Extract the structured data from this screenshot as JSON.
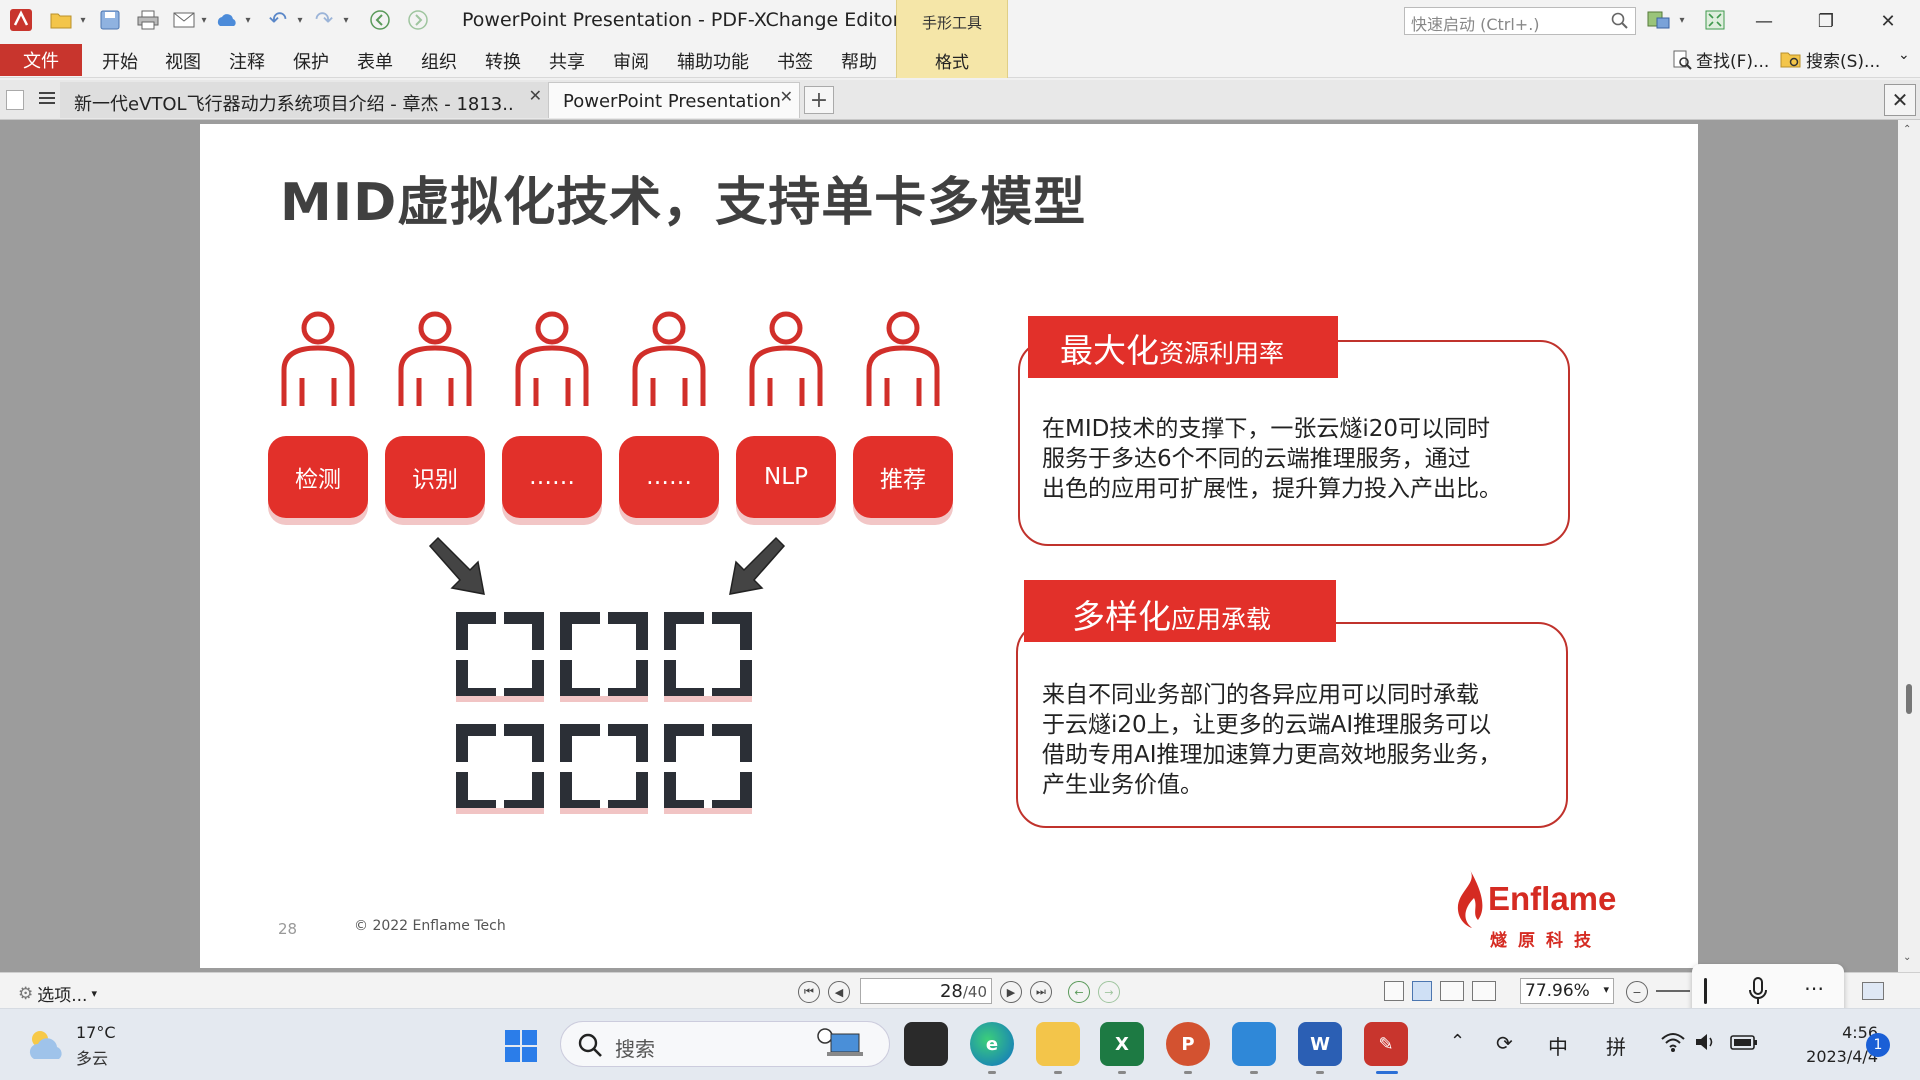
{
  "window": {
    "title": "PowerPoint Presentation - PDF-XChange Editor",
    "context_tab_group": "手形工具",
    "context_tab": "格式",
    "quick_launch_placeholder": "快速启动 (Ctrl+.)"
  },
  "menu": {
    "file": "文件",
    "items": [
      "开始",
      "视图",
      "注释",
      "保护",
      "表单",
      "组织",
      "转换",
      "共享",
      "审阅",
      "辅助功能",
      "书签",
      "帮助"
    ],
    "find": "查找(F)...",
    "search": "搜索(S)..."
  },
  "tabs": [
    {
      "label": "新一代eVTOL飞行器动力系统项目介绍 - 章杰 - 1813.."
    },
    {
      "label": "PowerPoint Presentation"
    }
  ],
  "slide": {
    "title": "MID虚拟化技术，支持单卡多模型",
    "pills": [
      "检测",
      "识别",
      "……",
      "……",
      "NLP",
      "推荐"
    ],
    "callout1": {
      "head_big": "最大化",
      "head_small": "资源利用率",
      "body": [
        "在MID技术的支撑下，一张云燧i20可以同时",
        "服务于多达6个不同的云端推理服务，通过",
        "出色的应用可扩展性，提升算力投入产出比。"
      ]
    },
    "callout2": {
      "head_big": "多样化",
      "head_small": "应用承载",
      "body": [
        "来自不同业务部门的各异应用可以同时承载",
        "于云燧i20上，让更多的云端AI推理服务可以",
        "借助专用AI推理加速算力更高效地服务业务，",
        "产生业务价值。"
      ]
    },
    "page_number": "28",
    "copyright": "© 2022 Enflame Tech",
    "logo_name": "Enflame",
    "logo_cn": "燧原科技"
  },
  "status": {
    "options": "选项...",
    "current_page": "28",
    "total_pages": "/40",
    "zoom": "77.96%"
  },
  "taskbar": {
    "temperature": "17°C",
    "weather": "多云",
    "search": "搜索",
    "ime_lang": "中",
    "ime_mode": "拼",
    "time": "4:56",
    "date": "2023/4/4",
    "notifications": "1"
  },
  "colors": {
    "brand_red": "#e2302a",
    "file_button": "#c8352d",
    "context_tab": "#f5e6a8",
    "workspace": "#9c9c9c"
  }
}
